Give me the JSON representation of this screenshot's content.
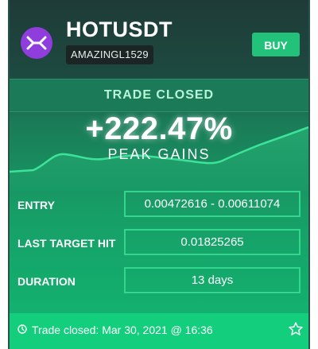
{
  "header": {
    "symbol": "HOTUSDT",
    "username": "AMAZINGL1529",
    "buy_label": "BUY",
    "logo_icon": "holo-logo-icon",
    "logo_color": "#8f3ddc",
    "buy_color": "#22c27a"
  },
  "status": {
    "label": "TRADE CLOSED"
  },
  "performance": {
    "gain": "+222.47%",
    "gain_label": "PEAK GAINS"
  },
  "details": {
    "entry_label": "ENTRY",
    "entry_value": "0.00472616 - 0.00611074",
    "target_label": "LAST TARGET HIT",
    "target_value": "0.01825265",
    "duration_label": "DURATION",
    "duration_value": "13 days"
  },
  "footer": {
    "closed_text": "Trade closed: Mar 30, 2021 @ 16:36",
    "clock_icon": "clock-icon",
    "star_icon": "star-icon"
  }
}
